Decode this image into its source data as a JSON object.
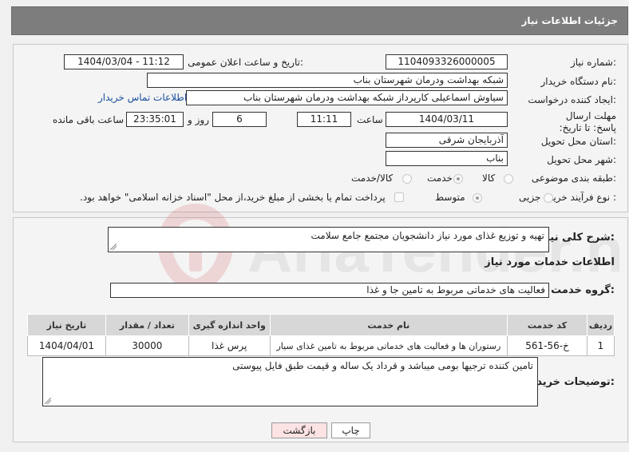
{
  "header": {
    "title": "جزئیات اطلاعات نیاز"
  },
  "need_number": {
    "label": "شماره نیاز:",
    "value": "1104093326000005"
  },
  "announce_datetime": {
    "label": "تاریخ و ساعت اعلان عمومی:",
    "value": "1404/03/04 - 11:12"
  },
  "buyer_org": {
    "label": "نام دستگاه خریدار:",
    "value": "شبکه بهداشت ودرمان شهرستان بناب"
  },
  "requester": {
    "label": "ایجاد کننده درخواست:",
    "value": "سیاوش اسماعیلی کارپرداز شبکه بهداشت ودرمان شهرستان بناب",
    "contact_link": "اطلاعات تماس خریدار"
  },
  "deadline": {
    "label": "مهلت ارسال پاسخ: تا تاریخ:",
    "date": "1404/03/11",
    "time_label": "ساعت",
    "time": "11:11",
    "days": "6",
    "days_label": "روز و",
    "remaining": "23:35:01",
    "remaining_label": "ساعت باقی مانده"
  },
  "province": {
    "label": "استان محل تحویل:",
    "value": "آذربایجان شرقی"
  },
  "city": {
    "label": "شهر محل تحویل:",
    "value": "بناب"
  },
  "category": {
    "label": "طبقه بندی موضوعی:",
    "options": [
      "کالا",
      "خدمت",
      "کالا/خدمت"
    ],
    "selected": "خدمت"
  },
  "process_type": {
    "label": "نوع فرآیند خرید :",
    "options": [
      "جزیی",
      "متوسط"
    ],
    "selected": "متوسط",
    "payment_note": "پرداخت تمام یا بخشی از مبلغ خرید،از محل \"اسناد خزانه اسلامی\" خواهد بود."
  },
  "summary": {
    "label": "شرح کلی نیاز:",
    "value": "تهیه و توزیع غذای مورد نیاز دانشجویان مجتمع جامع سلامت"
  },
  "services": {
    "section_title": "اطلاعات خدمات مورد نیاز",
    "group_label": "گروه خدمت:",
    "group_value": "فعالیت های خدماتی مربوط به تامین جا و غذا",
    "columns": [
      "ردیف",
      "کد خدمت",
      "نام خدمت",
      "واحد اندازه گیری",
      "تعداد / مقدار",
      "تاریخ نیاز"
    ],
    "rows": [
      {
        "row": "1",
        "code": "خ-56-561",
        "name": "رستوران ها و فعالیت های خدماتی مربوط به تامین غذای سیار",
        "unit": "پرس غذا",
        "qty": "30000",
        "date": "1404/04/01"
      }
    ]
  },
  "buyer_notes": {
    "label": "توضیحات خریدار:",
    "value": "تامین کننده ترجیها بومی میباشد و قرداد یک ساله و قیمت طبق فایل پیوستی"
  },
  "buttons": {
    "print": "چاپ",
    "back": "بازگشت"
  },
  "watermark": {
    "text": "AriaTender.neT"
  }
}
